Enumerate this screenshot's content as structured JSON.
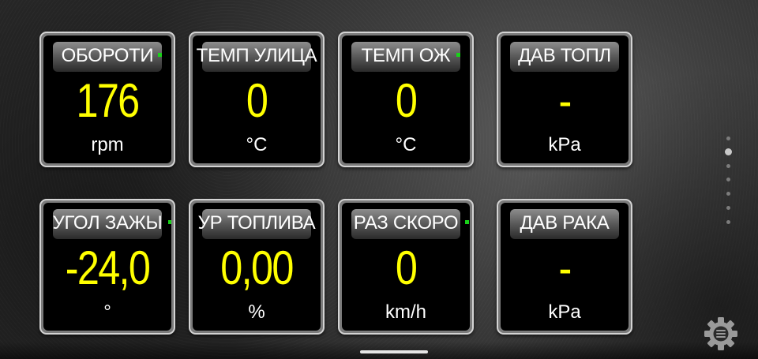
{
  "gauges": [
    {
      "title": "ОБОРОТИ",
      "value": "176",
      "unit": "rpm",
      "status_dot": true
    },
    {
      "title": "ТЕМП УЛИЦА",
      "value": "0",
      "unit": "°C",
      "status_dot": false
    },
    {
      "title": "ТЕМП ОЖ",
      "value": "0",
      "unit": "°C",
      "status_dot": true
    },
    {
      "title": "ДАВ ТОПЛ",
      "value": "-",
      "unit": "kPa",
      "status_dot": false
    },
    {
      "title": "УГОЛ ЗАЖЫ",
      "value": "-24,0",
      "unit": "°",
      "status_dot": true
    },
    {
      "title": "УР ТОПЛИВА",
      "value": "0,00",
      "unit": "%",
      "status_dot": false
    },
    {
      "title": "РАЗ СКОРО",
      "value": "0",
      "unit": "km/h",
      "status_dot": true
    },
    {
      "title": "ДАВ РАКА",
      "value": "-",
      "unit": "kPa",
      "status_dot": false
    }
  ],
  "pager": {
    "pages": 6,
    "current": 2
  },
  "colors": {
    "value": "#ffff00",
    "label": "#ffffff",
    "status_dot": "#19d219",
    "tile_border": "#d4d4d4"
  },
  "icons": {
    "settings": "gear-icon",
    "status": "status-dot-icon"
  }
}
